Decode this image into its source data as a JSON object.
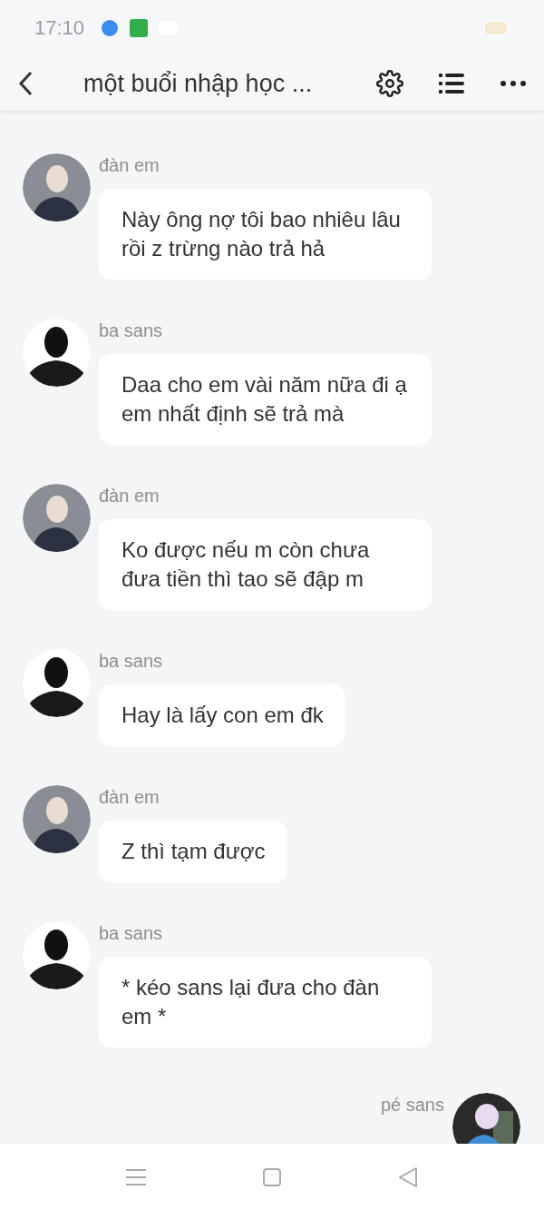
{
  "status_bar": {
    "time": "17:10"
  },
  "header": {
    "title": "một buổi nhập học ..."
  },
  "messages": [
    {
      "kind": "incoming",
      "avatar": {
        "kind": "figure"
      },
      "sender": "đàn em",
      "text": "Này ông nợ tôi bao nhiêu lâu rồi z trừng nào trả hả"
    },
    {
      "kind": "incoming",
      "avatar": {
        "kind": "silhouette"
      },
      "sender": "ba sans",
      "text": "Daa cho em vài năm nữa đi ạ em nhất định sẽ trả mà"
    },
    {
      "kind": "incoming",
      "avatar": {
        "kind": "figure"
      },
      "sender": "đàn em",
      "text": "Ko được nếu m còn chưa đưa tiền thì tao sẽ đập m"
    },
    {
      "kind": "incoming",
      "avatar": {
        "kind": "silhouette"
      },
      "sender": "ba sans",
      "text": "Hay là lấy con em đk"
    },
    {
      "kind": "incoming",
      "avatar": {
        "kind": "figure"
      },
      "sender": "đàn em",
      "text": "Z thì tạm được"
    },
    {
      "kind": "incoming",
      "avatar": {
        "kind": "silhouette"
      },
      "sender": "ba sans",
      "text": "* kéo sans lại đưa cho đàn em *"
    },
    {
      "kind": "outgoing",
      "sender": "pé sans"
    }
  ]
}
